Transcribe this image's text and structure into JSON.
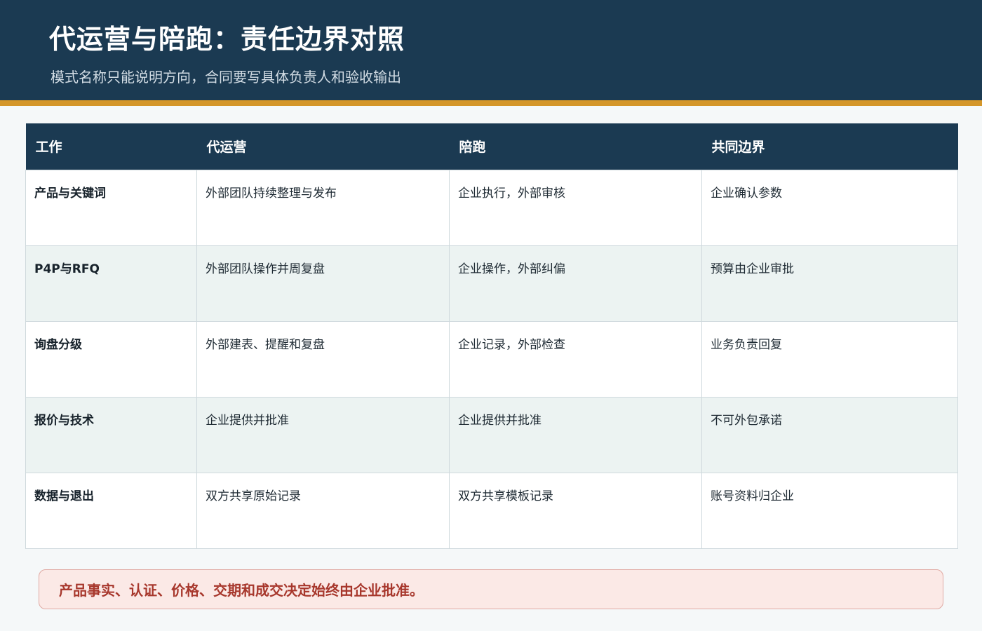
{
  "header": {
    "title": "代运营与陪跑：责任边界对照",
    "subtitle": "模式名称只能说明方向，合同要写具体负责人和验收输出"
  },
  "table": {
    "columns": [
      "工作",
      "代运营",
      "陪跑",
      "共同边界"
    ],
    "rows": [
      [
        "产品与关键词",
        "外部团队持续整理与发布",
        "企业执行，外部审核",
        "企业确认参数"
      ],
      [
        "P4P与RFQ",
        "外部团队操作并周复盘",
        "企业操作，外部纠偏",
        "预算由企业审批"
      ],
      [
        "询盘分级",
        "外部建表、提醒和复盘",
        "企业记录，外部检查",
        "业务负责回复"
      ],
      [
        "报价与技术",
        "企业提供并批准",
        "企业提供并批准",
        "不可外包承诺"
      ],
      [
        "数据与退出",
        "双方共享原始记录",
        "双方共享模板记录",
        "账号资料归企业"
      ]
    ]
  },
  "notice": {
    "text": "产品事实、认证、价格、交期和成交决定始终由企业批准。"
  },
  "colors": {
    "header_bg": "#1b3a52",
    "accent_bar": "#d4962a",
    "notice_text": "#a7372c",
    "notice_bg": "#fbe9e6"
  }
}
